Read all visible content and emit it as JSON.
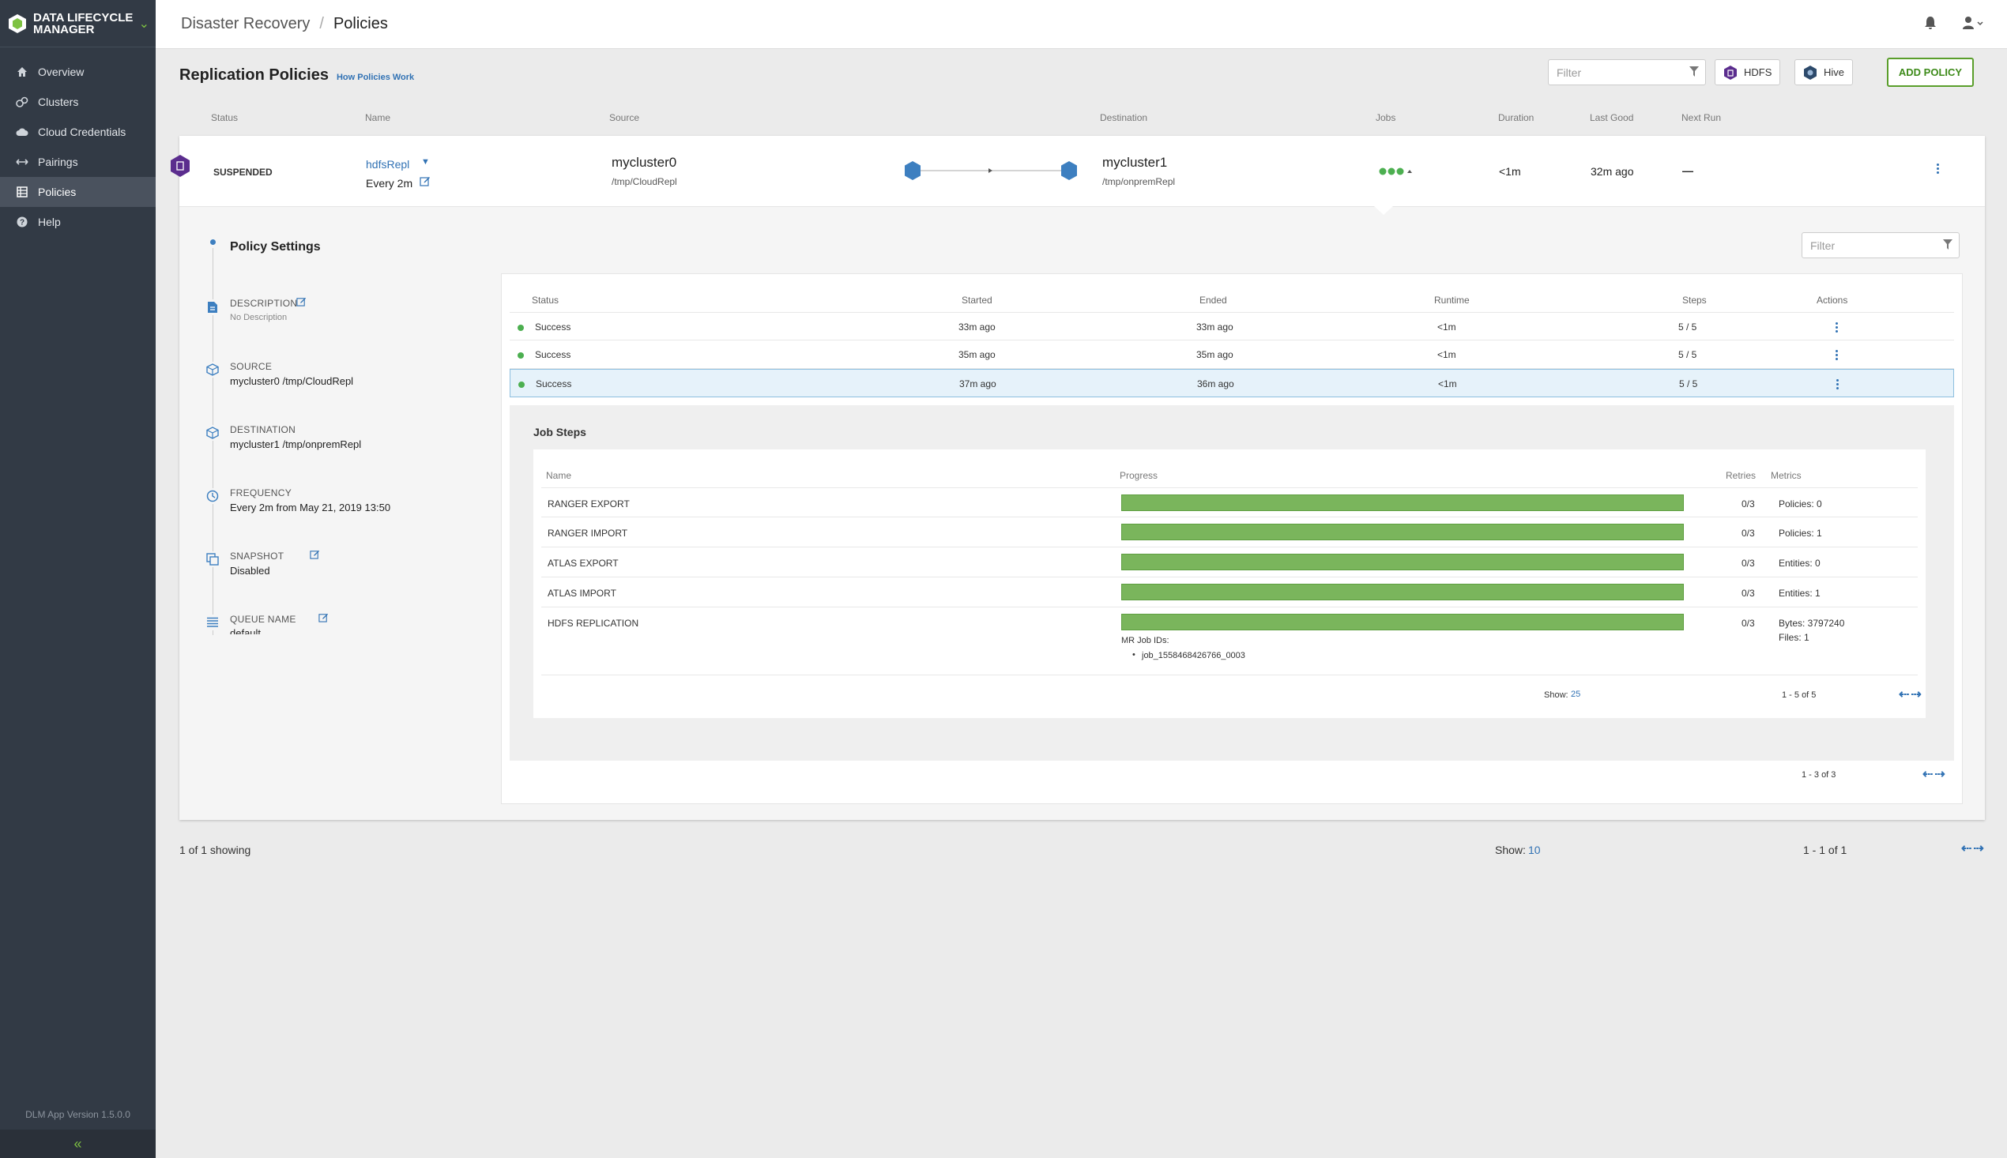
{
  "app": {
    "title": "DATA LIFECYCLE MANAGER",
    "version": "DLM App Version 1.5.0.0"
  },
  "nav": [
    {
      "label": "Overview",
      "icon": "home-icon"
    },
    {
      "label": "Clusters",
      "icon": "clusters-icon"
    },
    {
      "label": "Cloud Credentials",
      "icon": "cloud-icon"
    },
    {
      "label": "Pairings",
      "icon": "pairings-icon"
    },
    {
      "label": "Policies",
      "icon": "policies-icon",
      "active": true
    },
    {
      "label": "Help",
      "icon": "help-icon"
    }
  ],
  "breadcrumb": {
    "parent": "Disaster Recovery",
    "current": "Policies"
  },
  "header": {
    "title": "Replication Policies",
    "help_link": "How Policies Work",
    "filter_placeholder": "Filter",
    "hdfs": "HDFS",
    "hive": "Hive",
    "add_policy": "ADD POLICY"
  },
  "columns": {
    "status": "Status",
    "name": "Name",
    "source": "Source",
    "destination": "Destination",
    "jobs": "Jobs",
    "duration": "Duration",
    "last_good": "Last Good",
    "next_run": "Next Run"
  },
  "policy": {
    "status": "SUSPENDED",
    "name": "hdfsRepl",
    "frequency": "Every 2m",
    "source_cluster": "mycluster0",
    "source_path": "/tmp/CloudRepl",
    "dest_cluster": "mycluster1",
    "dest_path": "/tmp/onpremRepl",
    "duration": "<1m",
    "last_good": "32m ago",
    "next_run": "—"
  },
  "settings": {
    "title": "Policy Settings",
    "description_label": "DESCRIPTION",
    "description_value": "No Description",
    "source_label": "SOURCE",
    "source_value": "mycluster0 /tmp/CloudRepl",
    "destination_label": "DESTINATION",
    "destination_value": "mycluster1 /tmp/onpremRepl",
    "frequency_label": "FREQUENCY",
    "frequency_value": "Every 2m from May 21, 2019 13:50",
    "snapshot_label": "SNAPSHOT",
    "snapshot_value": "Disabled",
    "queue_label": "QUEUE NAME",
    "queue_value": "default"
  },
  "jobs": {
    "filter_placeholder": "Filter",
    "headers": {
      "status": "Status",
      "started": "Started",
      "ended": "Ended",
      "runtime": "Runtime",
      "steps": "Steps",
      "actions": "Actions"
    },
    "rows": [
      {
        "status": "Success",
        "started": "33m ago",
        "ended": "33m ago",
        "runtime": "<1m",
        "steps": "5 / 5"
      },
      {
        "status": "Success",
        "started": "35m ago",
        "ended": "35m ago",
        "runtime": "<1m",
        "steps": "5 / 5"
      },
      {
        "status": "Success",
        "started": "37m ago",
        "ended": "36m ago",
        "runtime": "<1m",
        "steps": "5 / 5"
      }
    ],
    "pager": "1 - 3 of 3"
  },
  "job_steps": {
    "title": "Job Steps",
    "headers": {
      "name": "Name",
      "progress": "Progress",
      "retries": "Retries",
      "metrics": "Metrics"
    },
    "rows": [
      {
        "name": "RANGER EXPORT",
        "progress": 1.0,
        "retries": "0/3",
        "metrics": "Policies: 0"
      },
      {
        "name": "RANGER IMPORT",
        "progress": 1.0,
        "retries": "0/3",
        "metrics": "Policies: 1"
      },
      {
        "name": "ATLAS EXPORT",
        "progress": 1.0,
        "retries": "0/3",
        "metrics": "Entities: 0"
      },
      {
        "name": "ATLAS IMPORT",
        "progress": 1.0,
        "retries": "0/3",
        "metrics": "Entities: 1"
      },
      {
        "name": "HDFS REPLICATION",
        "progress": 1.0,
        "retries": "0/3",
        "metrics": "Bytes: 3797240",
        "metrics2": "Files: 1",
        "mr_label": "MR Job IDs:",
        "mr_job": "job_1558468426766_0003"
      }
    ],
    "show_label": "Show:",
    "show_value": "25",
    "pager": "1 - 5 of 5"
  },
  "footer": {
    "showing": "1 of 1 showing",
    "show_label": "Show:",
    "show_value": "10",
    "pager": "1 - 1 of 1"
  },
  "colors": {
    "accent": "#3172b4",
    "success": "#4caf50",
    "bar": "#7ab55c",
    "sidebar": "#323a45",
    "brand_green": "#7ec242",
    "hdfs": "#5b2d8e",
    "hex_blue": "#3d7fc0"
  }
}
